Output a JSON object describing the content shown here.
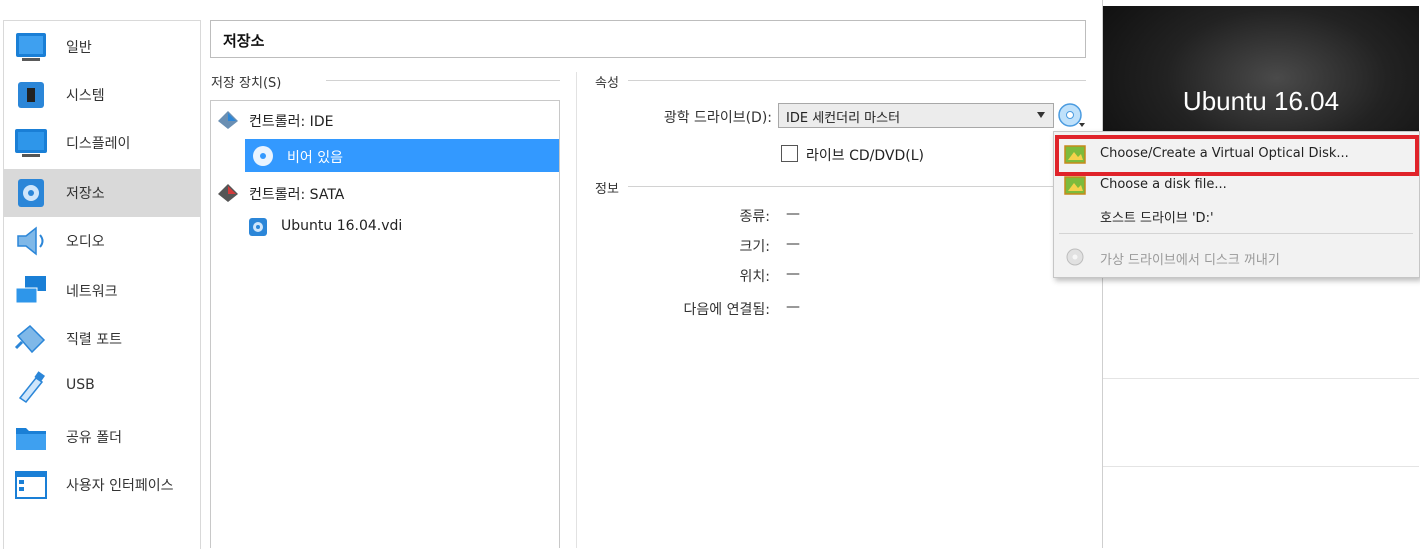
{
  "sidebar": {
    "items": [
      {
        "label": "일반",
        "icon": "general-icon"
      },
      {
        "label": "시스템",
        "icon": "system-icon"
      },
      {
        "label": "디스플레이",
        "icon": "display-icon"
      },
      {
        "label": "저장소",
        "icon": "storage-icon",
        "selected": true
      },
      {
        "label": "오디오",
        "icon": "audio-icon"
      },
      {
        "label": "네트워크",
        "icon": "network-icon"
      },
      {
        "label": "직렬 포트",
        "icon": "serial-port-icon"
      },
      {
        "label": "USB",
        "icon": "usb-icon"
      },
      {
        "label": "공유 폴더",
        "icon": "shared-folder-icon"
      },
      {
        "label": "사용자 인터페이스",
        "icon": "user-interface-icon"
      }
    ]
  },
  "page": {
    "title": "저장소"
  },
  "storage": {
    "header": "저장 장치(S)",
    "tree": [
      {
        "label": "컨트롤러: IDE",
        "icon": "ide-controller-icon"
      },
      {
        "label": "비어 있음",
        "icon": "optical-disk-icon",
        "selected": true
      },
      {
        "label": "컨트롤러: SATA",
        "icon": "sata-controller-icon"
      },
      {
        "label": "Ubuntu 16.04.vdi",
        "icon": "hard-disk-icon"
      }
    ]
  },
  "attributes": {
    "header": "속성",
    "optical_drive_label": "광학 드라이브(D):",
    "optical_drive_value": "IDE 세컨더리 마스터",
    "live_cd_label": "라이브 CD/DVD(L)",
    "live_cd_checked": false
  },
  "info": {
    "header": "정보",
    "rows": [
      {
        "label": "종류:",
        "value": "—"
      },
      {
        "label": "크기:",
        "value": "—"
      },
      {
        "label": "위치:",
        "value": "—"
      },
      {
        "label": "다음에 연결됨:",
        "value": "—"
      }
    ]
  },
  "menu": {
    "items": [
      {
        "label": "Choose/Create a Virtual Optical Disk...",
        "icon": "optical-image-icon",
        "highlighted": true
      },
      {
        "label": "Choose a disk file...",
        "icon": "disk-file-icon"
      },
      {
        "label": "호스트 드라이브 'D:'",
        "icon": ""
      },
      {
        "label": "가상 드라이브에서 디스크 꺼내기",
        "icon": "eject-disk-icon",
        "disabled": true
      }
    ]
  },
  "preview": {
    "label": "Ubuntu 16.04"
  },
  "colors": {
    "selection": "#3399ff",
    "highlight_border": "#e0232a",
    "sidebar_selected": "#d9d9d9"
  }
}
